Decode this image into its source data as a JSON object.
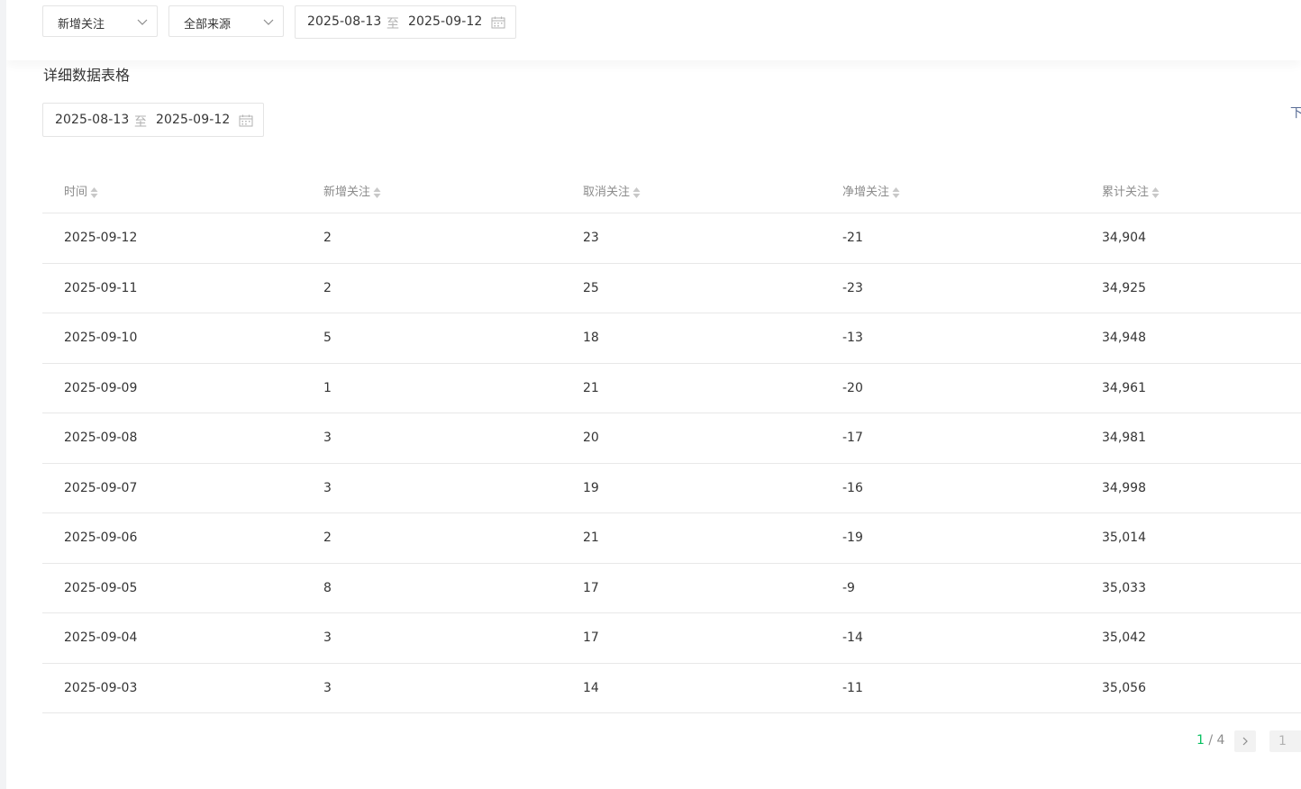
{
  "filters": {
    "type_select": "新增关注",
    "source_select": "全部来源",
    "date_range": {
      "start": "2025-08-13",
      "separator": "至",
      "end": "2025-09-12"
    }
  },
  "detail": {
    "title": "详细数据表格",
    "date_range": {
      "start": "2025-08-13",
      "separator": "至",
      "end": "2025-09-12"
    },
    "download_label": "下"
  },
  "table": {
    "columns": [
      "时间",
      "新增关注",
      "取消关注",
      "净增关注",
      "累计关注"
    ],
    "rows": [
      [
        "2025-09-12",
        "2",
        "23",
        "-21",
        "34,904"
      ],
      [
        "2025-09-11",
        "2",
        "25",
        "-23",
        "34,925"
      ],
      [
        "2025-09-10",
        "5",
        "18",
        "-13",
        "34,948"
      ],
      [
        "2025-09-09",
        "1",
        "21",
        "-20",
        "34,961"
      ],
      [
        "2025-09-08",
        "3",
        "20",
        "-17",
        "34,981"
      ],
      [
        "2025-09-07",
        "3",
        "19",
        "-16",
        "34,998"
      ],
      [
        "2025-09-06",
        "2",
        "21",
        "-19",
        "35,014"
      ],
      [
        "2025-09-05",
        "8",
        "17",
        "-9",
        "35,033"
      ],
      [
        "2025-09-04",
        "3",
        "17",
        "-14",
        "35,042"
      ],
      [
        "2025-09-03",
        "3",
        "14",
        "-11",
        "35,056"
      ]
    ]
  },
  "pagination": {
    "current": "1",
    "separator": " / ",
    "total": "4",
    "input_value": "1"
  },
  "colors": {
    "accent_green": "#07c160",
    "text": "#353535",
    "muted": "#8c8c8c",
    "border": "#e4e4e4"
  },
  "icons": {
    "dropdown": "chevron-down-icon",
    "calendar": "calendar-icon",
    "sort": "sort-icon",
    "next": "chevron-right-icon"
  }
}
